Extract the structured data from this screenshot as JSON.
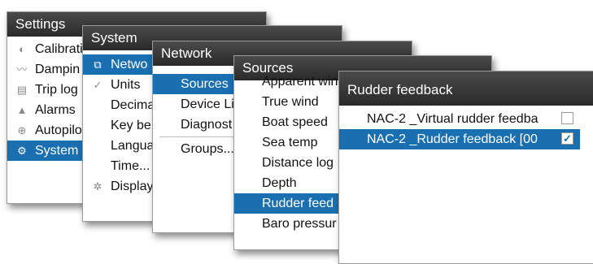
{
  "settings": {
    "title": "Settings",
    "items": [
      {
        "label": "Calibrati",
        "icon": "calibration-icon"
      },
      {
        "label": "Dampin",
        "icon": "damping-icon"
      },
      {
        "label": "Trip log",
        "icon": "trip-log-icon"
      },
      {
        "label": "Alarms",
        "icon": "alarm-bell-icon"
      },
      {
        "label": "Autopilo",
        "icon": "autopilot-icon"
      },
      {
        "label": "System",
        "icon": "gear-icon"
      }
    ]
  },
  "system": {
    "title": "System",
    "items": [
      {
        "label": "Netwo",
        "icon": "network-icon"
      },
      {
        "label": "Units",
        "icon": "units-icon"
      },
      {
        "label": "Decima"
      },
      {
        "label": "Key be"
      },
      {
        "label": "Langua"
      },
      {
        "label": "Time..."
      },
      {
        "label": "Display",
        "icon": "display-icon"
      }
    ]
  },
  "network": {
    "title": "Network",
    "items": [
      {
        "label": "Sources"
      },
      {
        "label": "Device Li"
      },
      {
        "label": "Diagnost"
      },
      {
        "label": "Groups..."
      }
    ]
  },
  "sources": {
    "title": "Sources",
    "items": [
      {
        "label": "Apparent wind"
      },
      {
        "label": "True wind"
      },
      {
        "label": "Boat speed"
      },
      {
        "label": "Sea temp"
      },
      {
        "label": "Distance log"
      },
      {
        "label": "Depth"
      },
      {
        "label": "Rudder feed"
      },
      {
        "label": "Baro pressur"
      }
    ]
  },
  "rudder": {
    "title": "Rudder feedback",
    "items": [
      {
        "label": "NAC-2 _Virtual rudder feedba",
        "checked": false
      },
      {
        "label": "NAC-2 _Rudder feedback [00",
        "checked": true
      }
    ]
  }
}
